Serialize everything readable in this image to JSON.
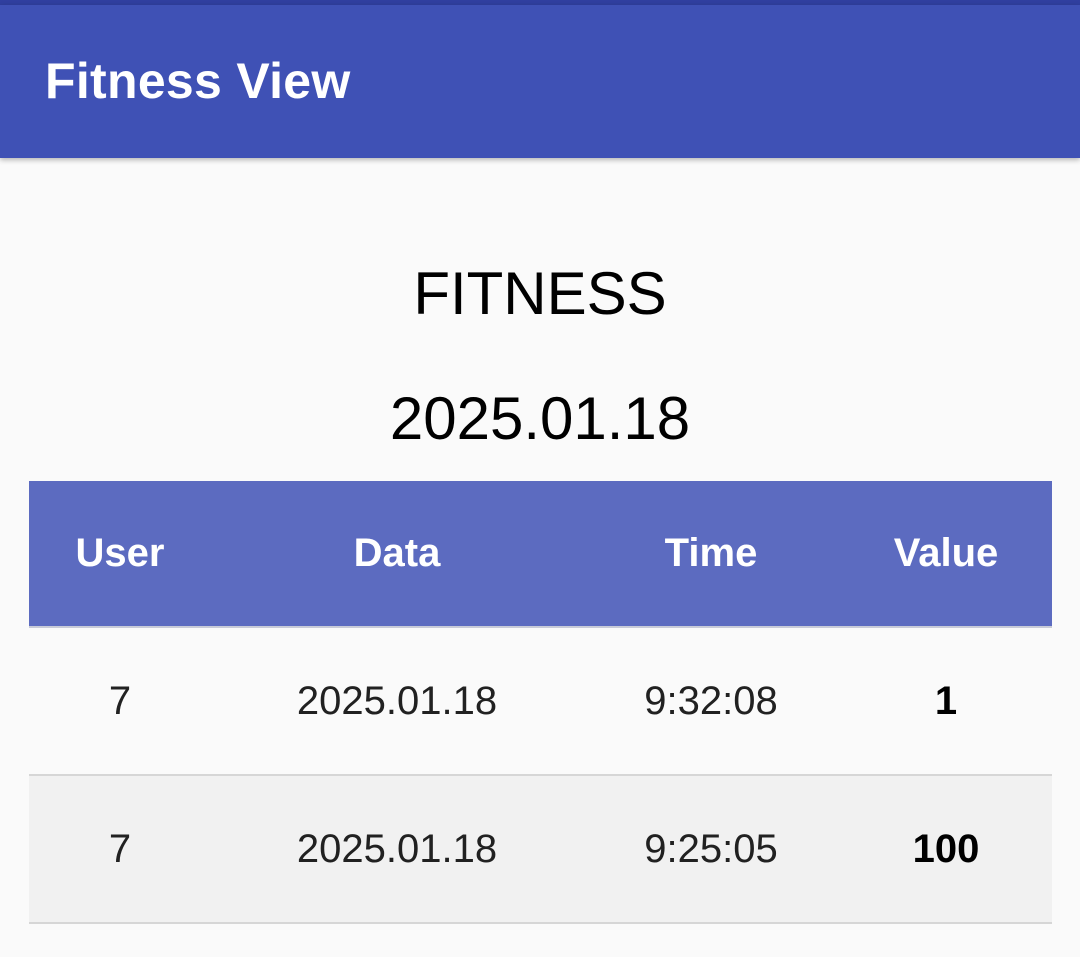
{
  "app_bar": {
    "title": "Fitness View"
  },
  "main": {
    "heading": "FITNESS",
    "date": "2025.01.18"
  },
  "table": {
    "columns": [
      "User",
      "Data",
      "Time",
      "Value"
    ],
    "rows": [
      {
        "user": "7",
        "data": "2025.01.18",
        "time": "9:32:08",
        "value": "1"
      },
      {
        "user": "7",
        "data": "2025.01.18",
        "time": "9:25:05",
        "value": "100"
      }
    ]
  },
  "colors": {
    "app_bar": "#3f51b5",
    "status_strip": "#303f9f",
    "table_header": "#5c6bc0",
    "background": "#fafafa",
    "alt_row": "#f1f1f1"
  }
}
